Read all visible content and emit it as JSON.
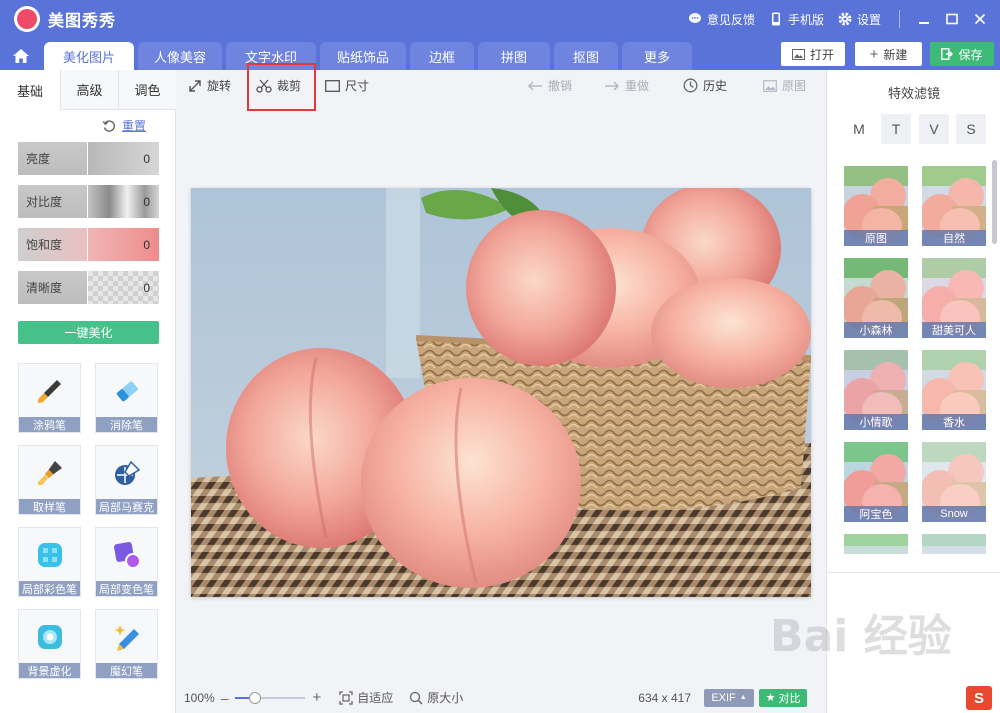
{
  "app": {
    "title": "美图秀秀"
  },
  "titlebar": {
    "feedback": "意见反馈",
    "mobile": "手机版",
    "settings": "设置"
  },
  "tabs": [
    {
      "label": "美化图片",
      "active": true
    },
    {
      "label": "人像美容",
      "active": false
    },
    {
      "label": "文字水印",
      "active": false
    },
    {
      "label": "贴纸饰品",
      "active": false
    },
    {
      "label": "边框",
      "active": false
    },
    {
      "label": "拼图",
      "active": false
    },
    {
      "label": "抠图",
      "active": false
    },
    {
      "label": "更多",
      "active": false
    }
  ],
  "actions": {
    "open": "打开",
    "new": "新建",
    "save": "保存"
  },
  "left": {
    "tabs": [
      "基础",
      "高级",
      "调色"
    ],
    "reset": "重置",
    "sliders": [
      {
        "label": "亮度",
        "value": "0"
      },
      {
        "label": "对比度",
        "value": "0"
      },
      {
        "label": "饱和度",
        "value": "0"
      },
      {
        "label": "清晰度",
        "value": "0"
      }
    ],
    "one_click": "一键美化",
    "tools": [
      "涂鸦笔",
      "消除笔",
      "取样笔",
      "局部马赛克",
      "局部彩色笔",
      "局部变色笔",
      "背景虚化",
      "魔幻笔"
    ]
  },
  "toolbar": {
    "rotate": "旋转",
    "crop": "裁剪",
    "size": "尺寸",
    "undo": "撤销",
    "redo": "重做",
    "history": "历史",
    "original": "原图"
  },
  "bottom": {
    "zoom": "100%",
    "fit": "自适应",
    "actual": "原大小",
    "dims": "634 x 417",
    "exif": "EXIF",
    "compare": "对比"
  },
  "right": {
    "title": "特效滤镜",
    "categories": [
      "M",
      "T",
      "V",
      "S"
    ],
    "filters": [
      "原图",
      "自然",
      "小森林",
      "甜美可人",
      "小情歌",
      "香水",
      "阿宝色",
      "Snow"
    ]
  },
  "watermark": "Bai 经验"
}
